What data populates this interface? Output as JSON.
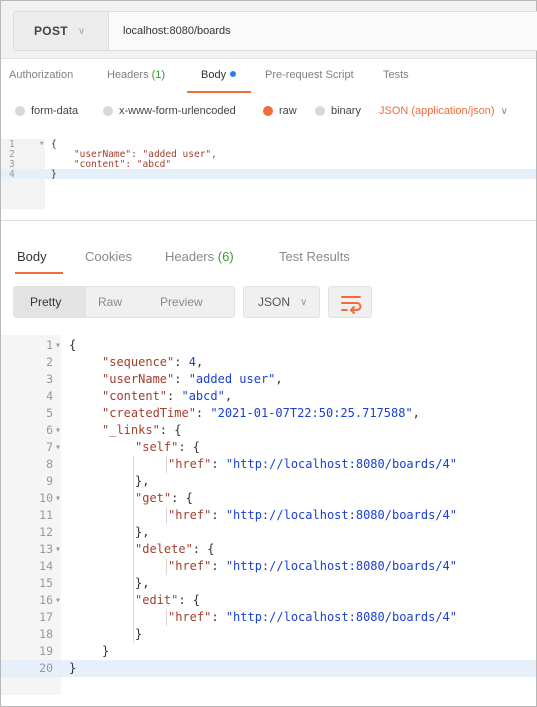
{
  "request": {
    "method": "POST",
    "url": "localhost:8080/boards",
    "tabs": [
      {
        "label": "Authorization",
        "count": ""
      },
      {
        "label": "Headers",
        "count": "(1)"
      },
      {
        "label": "Body",
        "count": ""
      },
      {
        "label": "Pre-request Script",
        "count": ""
      },
      {
        "label": "Tests",
        "count": ""
      }
    ],
    "body_types": [
      "form-data",
      "x-www-form-urlencoded",
      "raw",
      "binary"
    ],
    "selected_body_type": "raw",
    "content_type": "JSON (application/json)",
    "editor_lines": [
      {
        "n": "1",
        "text": "{"
      },
      {
        "n": "2",
        "text": "    \"userName\": \"added user\","
      },
      {
        "n": "3",
        "text": "    \"content\": \"abcd\""
      },
      {
        "n": "4",
        "text": "}"
      }
    ]
  },
  "response": {
    "tabs": [
      {
        "label": "Body",
        "count": ""
      },
      {
        "label": "Cookies",
        "count": ""
      },
      {
        "label": "Headers",
        "count": "(6)"
      },
      {
        "label": "Test Results",
        "count": ""
      }
    ],
    "views": [
      "Pretty",
      "Raw",
      "Preview"
    ],
    "format": "JSON",
    "lines": [
      {
        "n": "1",
        "fold": true,
        "indent": 0,
        "parts": [
          [
            "p",
            "{"
          ]
        ]
      },
      {
        "n": "2",
        "fold": false,
        "indent": 1,
        "parts": [
          [
            "k",
            "\"sequence\""
          ],
          [
            "p",
            ": "
          ],
          [
            "n",
            "4"
          ],
          [
            "p",
            ","
          ]
        ]
      },
      {
        "n": "3",
        "fold": false,
        "indent": 1,
        "parts": [
          [
            "k",
            "\"userName\""
          ],
          [
            "p",
            ": "
          ],
          [
            "s",
            "\"added user\""
          ],
          [
            "p",
            ","
          ]
        ]
      },
      {
        "n": "4",
        "fold": false,
        "indent": 1,
        "parts": [
          [
            "k",
            "\"content\""
          ],
          [
            "p",
            ": "
          ],
          [
            "s",
            "\"abcd\""
          ],
          [
            "p",
            ","
          ]
        ]
      },
      {
        "n": "5",
        "fold": false,
        "indent": 1,
        "parts": [
          [
            "k",
            "\"createdTime\""
          ],
          [
            "p",
            ": "
          ],
          [
            "s",
            "\"2021-01-07T22:50:25.717588\""
          ],
          [
            "p",
            ","
          ]
        ]
      },
      {
        "n": "6",
        "fold": true,
        "indent": 1,
        "parts": [
          [
            "k",
            "\"_links\""
          ],
          [
            "p",
            ": {"
          ]
        ]
      },
      {
        "n": "7",
        "fold": true,
        "indent": 2,
        "parts": [
          [
            "k",
            "\"self\""
          ],
          [
            "p",
            ": {"
          ]
        ]
      },
      {
        "n": "8",
        "fold": false,
        "indent": 3,
        "parts": [
          [
            "k",
            "\"href\""
          ],
          [
            "p",
            ": "
          ],
          [
            "s",
            "\"http://localhost:8080/boards/4\""
          ]
        ]
      },
      {
        "n": "9",
        "fold": false,
        "indent": 2,
        "parts": [
          [
            "p",
            "},"
          ]
        ]
      },
      {
        "n": "10",
        "fold": true,
        "indent": 2,
        "parts": [
          [
            "k",
            "\"get\""
          ],
          [
            "p",
            ": {"
          ]
        ]
      },
      {
        "n": "11",
        "fold": false,
        "indent": 3,
        "parts": [
          [
            "k",
            "\"href\""
          ],
          [
            "p",
            ": "
          ],
          [
            "s",
            "\"http://localhost:8080/boards/4\""
          ]
        ]
      },
      {
        "n": "12",
        "fold": false,
        "indent": 2,
        "parts": [
          [
            "p",
            "},"
          ]
        ]
      },
      {
        "n": "13",
        "fold": true,
        "indent": 2,
        "parts": [
          [
            "k",
            "\"delete\""
          ],
          [
            "p",
            ": {"
          ]
        ]
      },
      {
        "n": "14",
        "fold": false,
        "indent": 3,
        "parts": [
          [
            "k",
            "\"href\""
          ],
          [
            "p",
            ": "
          ],
          [
            "s",
            "\"http://localhost:8080/boards/4\""
          ]
        ]
      },
      {
        "n": "15",
        "fold": false,
        "indent": 2,
        "parts": [
          [
            "p",
            "},"
          ]
        ]
      },
      {
        "n": "16",
        "fold": true,
        "indent": 2,
        "parts": [
          [
            "k",
            "\"edit\""
          ],
          [
            "p",
            ": {"
          ]
        ]
      },
      {
        "n": "17",
        "fold": false,
        "indent": 3,
        "parts": [
          [
            "k",
            "\"href\""
          ],
          [
            "p",
            ": "
          ],
          [
            "s",
            "\"http://localhost:8080/boards/4\""
          ]
        ]
      },
      {
        "n": "18",
        "fold": false,
        "indent": 2,
        "parts": [
          [
            "p",
            "}"
          ]
        ]
      },
      {
        "n": "19",
        "fold": false,
        "indent": 1,
        "parts": [
          [
            "p",
            "}"
          ]
        ]
      },
      {
        "n": "20",
        "fold": false,
        "indent": 0,
        "parts": [
          [
            "p",
            "}"
          ]
        ]
      }
    ]
  },
  "icons": {
    "method_dropdown": "chevron-down-icon",
    "content_type_dropdown": "chevron-down-icon",
    "format_dropdown": "chevron-down-icon",
    "wrap": "wrap-lines-icon",
    "fold": "fold-arrow-icon"
  },
  "colors": {
    "accent": "#f26b3a",
    "active_dot": "#2b7de9",
    "count": "#3a9a3a",
    "json_key": "#a23f2e",
    "json_value": "#1a3fd2"
  }
}
